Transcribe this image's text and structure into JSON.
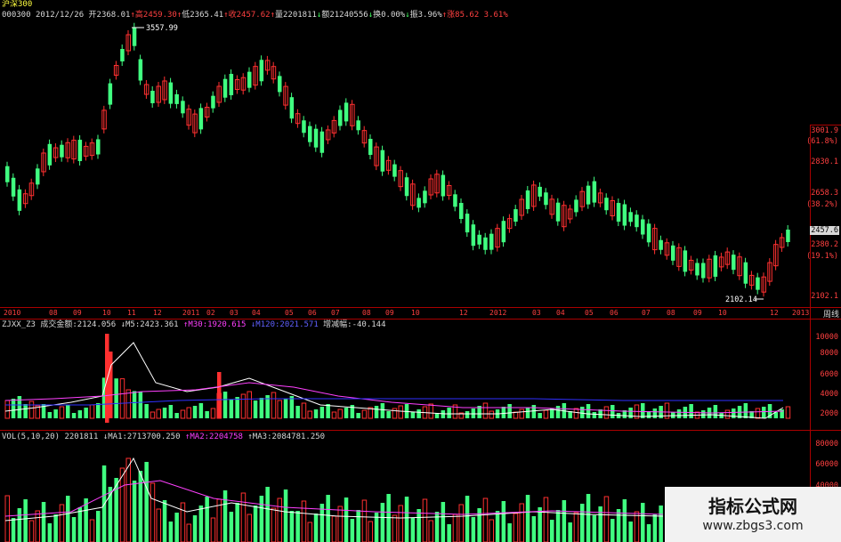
{
  "header": {
    "index_name": "沪深300",
    "code": "000300",
    "date": "2012/12/26",
    "open": "开2368.01",
    "high": "高2459.30",
    "low": "低2365.41",
    "close": "收2457.62",
    "volume": "量2201811",
    "amount": "额21240556",
    "turnover": "换0.00%",
    "amplitude": "振3.96%",
    "change": "涨85.62",
    "change_pct": "3.61%"
  },
  "main_chart": {
    "high_marker": "3557.99",
    "low_marker": "2102.14",
    "right_labels": [
      "3001.9",
      "(61.8%)",
      "2830.1",
      "2658.3",
      "(38.2%)",
      "2457.6",
      "2380.2",
      "(19.1%)",
      "2102.1"
    ],
    "period_label": "周线",
    "x_labels": [
      "2010",
      "08",
      "09",
      "10",
      "11",
      "12",
      "2011",
      "02",
      "03",
      "04",
      "05",
      "06",
      "07",
      "08",
      "09",
      "10",
      "12",
      "2012",
      "03",
      "04",
      "05",
      "06",
      "07",
      "08",
      "09",
      "10",
      "12",
      "2013"
    ]
  },
  "indicator1": {
    "name": "ZJXX_Z3",
    "amount_label": "成交金额:2124.056",
    "m5": "↓M5:2423.361",
    "m30": "↑M30:1920.615",
    "m_other": "↓M120:2021.571",
    "change_label": "增减幅:-40.144",
    "y_labels": [
      "10000",
      "8000",
      "6000",
      "4000",
      "2000"
    ]
  },
  "indicator2": {
    "name": "VOL(5,10,20)",
    "vol": "2201811",
    "ma1": "↓MA1:2713700.250",
    "ma2": "↑MA2:2204758",
    "ma3": "↑MA3:2084781.250",
    "y_labels": [
      "80000",
      "60000",
      "40000"
    ]
  },
  "watermark": {
    "title": "指标公式网",
    "url": "www.zbgs3.com"
  },
  "colors": {
    "up": "#ff3030",
    "down": "#40ff80",
    "ma_white": "#ffffff",
    "ma_magenta": "#ff40ff",
    "ma_blue": "#3030ff",
    "grid": "#aa0000"
  }
}
